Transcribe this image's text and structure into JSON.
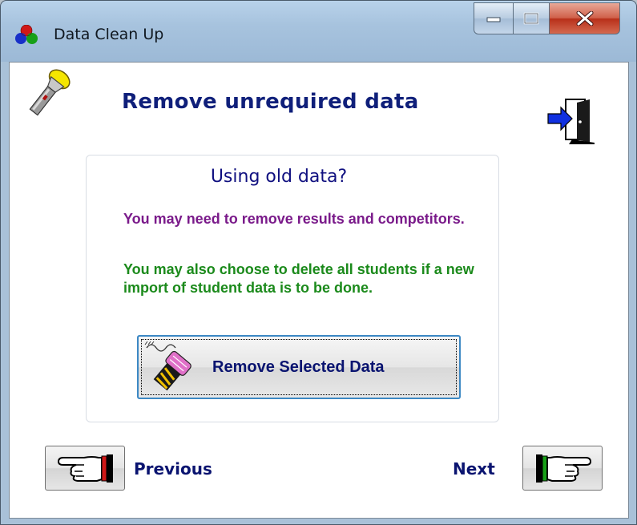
{
  "window": {
    "title": "Data Clean Up",
    "controls": {
      "minimize": "minimize",
      "maximize": "maximize",
      "close": "close"
    }
  },
  "page": {
    "heading": "Remove unrequired data"
  },
  "panel": {
    "title": "Using old data?",
    "message_results": "You may need to remove results and competitors.",
    "message_students": "You may also choose to delete all students if a new import of student data is to be done.",
    "remove_button_label": "Remove Selected Data"
  },
  "navigation": {
    "previous_label": "Previous",
    "next_label": "Next"
  },
  "icons": {
    "app": "tricolor-balls-icon",
    "torch": "flashlight-icon",
    "exit": "exit-door-icon",
    "remove": "eraser-icon",
    "previous": "pointing-hand-left-icon",
    "next": "pointing-hand-right-icon"
  },
  "colors": {
    "heading": "#0f1f7a",
    "message_results": "#7a1a8a",
    "message_students": "#1b8a1b",
    "close_button": "#c8452e",
    "focus_border": "#3c88c4"
  }
}
